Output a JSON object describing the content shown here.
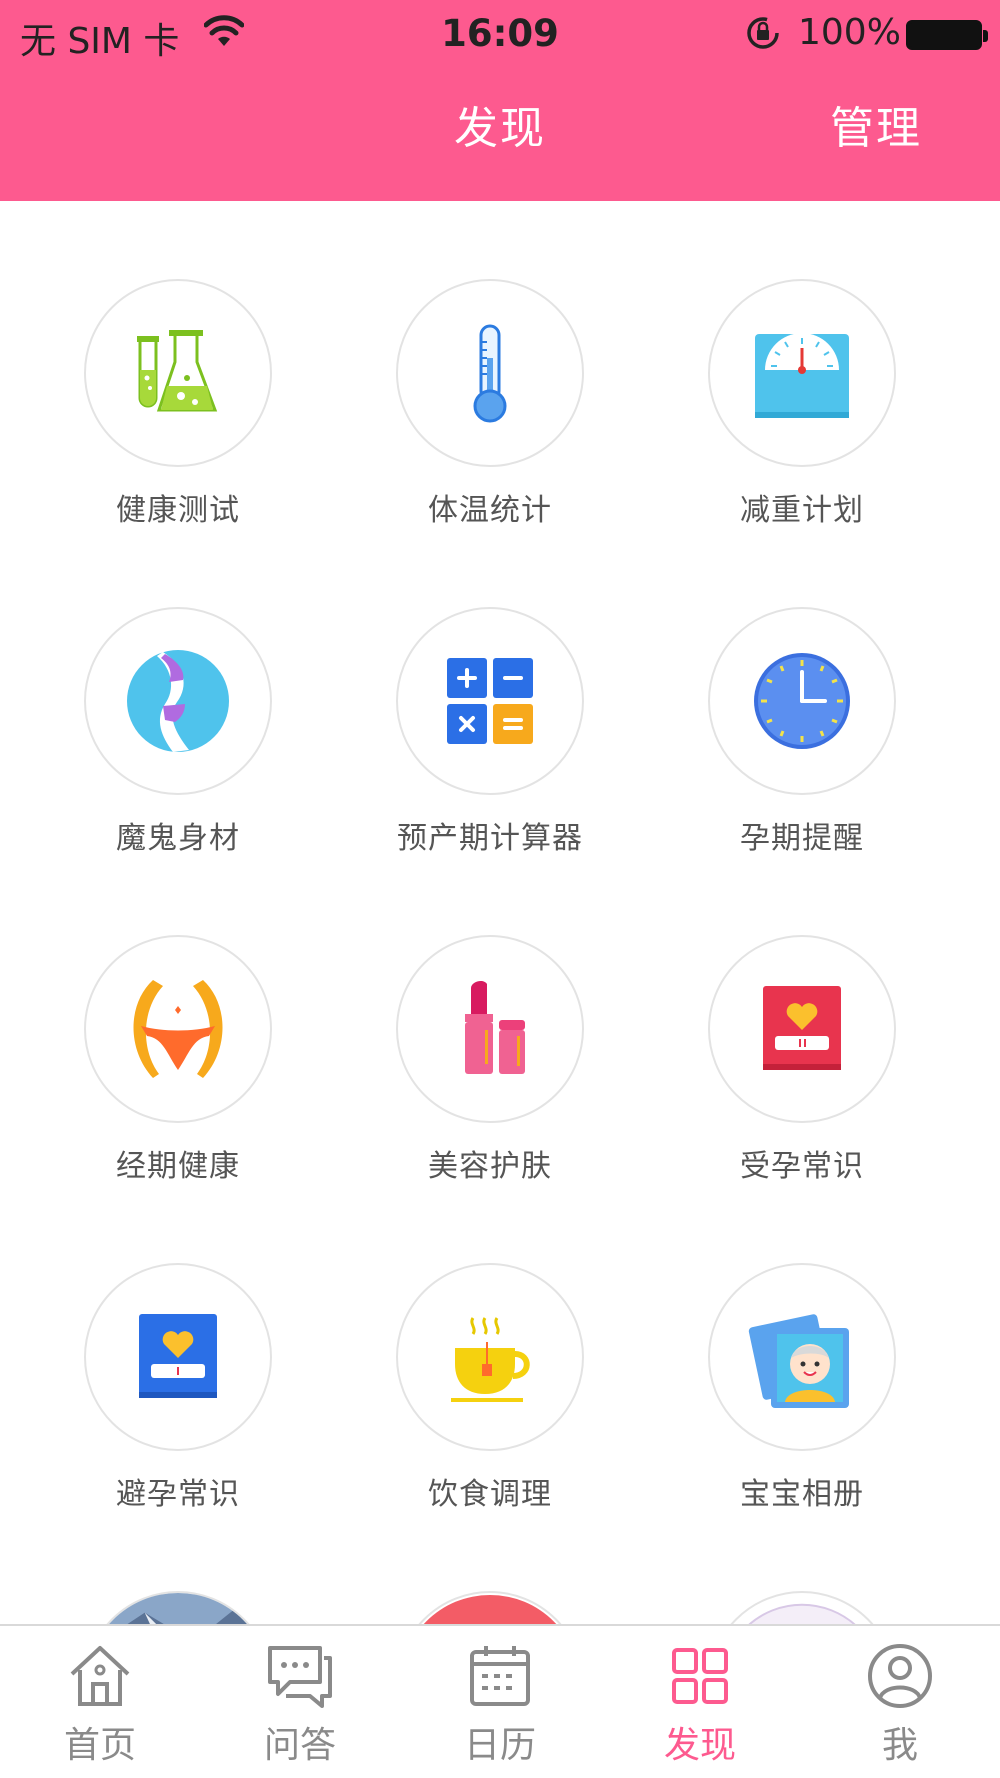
{
  "status_bar": {
    "carrier": "无 SIM 卡",
    "time": "16:09",
    "battery_percent": "100%"
  },
  "nav": {
    "title": "发现",
    "right_button": "管理"
  },
  "colors": {
    "brand_pink": "#fd5a8f",
    "label_gray": "#555555",
    "tab_gray": "#8a8a8a"
  },
  "grid_items": [
    {
      "label": "健康测试",
      "icon": "lab-flask-icon"
    },
    {
      "label": "体温统计",
      "icon": "thermometer-icon"
    },
    {
      "label": "减重计划",
      "icon": "scale-icon"
    },
    {
      "label": "魔鬼身材",
      "icon": "body-figure-icon"
    },
    {
      "label": "预产期计算器",
      "icon": "calculator-icon"
    },
    {
      "label": "孕期提醒",
      "icon": "clock-icon"
    },
    {
      "label": "经期健康",
      "icon": "waist-icon"
    },
    {
      "label": "美容护肤",
      "icon": "lipstick-icon"
    },
    {
      "label": "受孕常识",
      "icon": "red-book-heart-icon"
    },
    {
      "label": "避孕常识",
      "icon": "blue-book-heart-icon"
    },
    {
      "label": "饮食调理",
      "icon": "tea-cup-icon"
    },
    {
      "label": "宝宝相册",
      "icon": "baby-photo-icon"
    }
  ],
  "tabs": [
    {
      "label": "首页",
      "icon": "home-icon"
    },
    {
      "label": "问答",
      "icon": "chat-icon"
    },
    {
      "label": "日历",
      "icon": "calendar-icon"
    },
    {
      "label": "发现",
      "icon": "grid-icon",
      "active": true
    },
    {
      "label": "我",
      "icon": "user-icon"
    }
  ]
}
